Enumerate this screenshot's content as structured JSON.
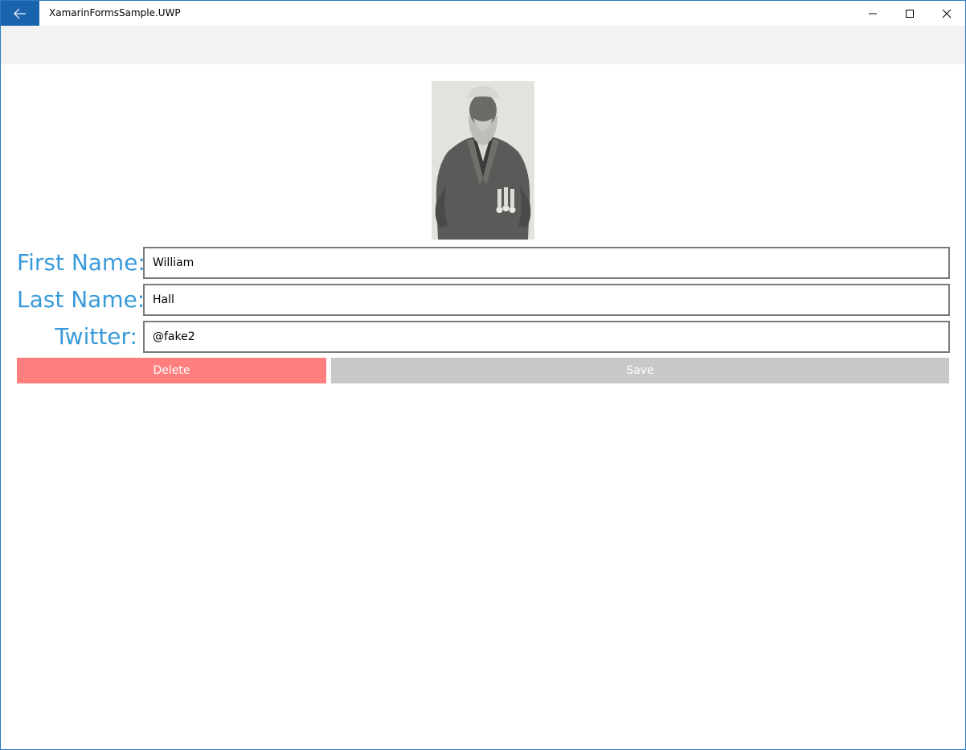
{
  "window": {
    "title": "XamarinFormsSample.UWP"
  },
  "icons": {
    "back": "back-arrow-icon",
    "minimize": "minimize-icon",
    "maximize": "maximize-icon",
    "close": "close-icon"
  },
  "colors": {
    "accent": "#1a63ad",
    "label": "#3a9ad9",
    "delete": "#ff7f7f",
    "save": "#c8c8c8",
    "commandbar": "#f2f2f2"
  },
  "form": {
    "first_name_label": "First Name:",
    "first_name_value": "William",
    "last_name_label": "Last Name:",
    "last_name_value": "Hall",
    "twitter_label": "Twitter:",
    "twitter_value": "@fake2"
  },
  "actions": {
    "delete_label": "Delete",
    "save_label": "Save"
  }
}
